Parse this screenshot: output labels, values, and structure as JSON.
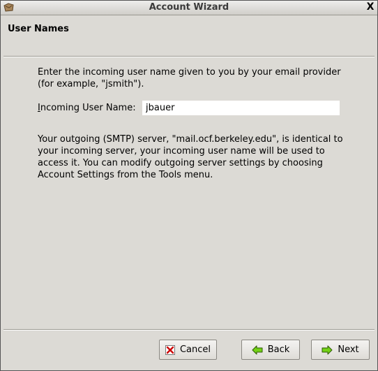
{
  "window": {
    "title": "Account Wizard",
    "close_glyph": "X"
  },
  "page": {
    "header": "User Names",
    "instruction": "Enter the incoming user name given to you by your email provider (for example, \"jsmith\").",
    "field_label_accel": "I",
    "field_label_rest": "ncoming User Name:",
    "field_value": "jbauer",
    "smtp_note": "Your outgoing (SMTP) server, \"mail.ocf.berkeley.edu\", is identical to your incoming server, your incoming user name will be used to access it. You can modify outgoing server settings by choosing Account Settings from the Tools menu."
  },
  "buttons": {
    "cancel": "Cancel",
    "back": "Back",
    "next": "Next"
  },
  "icons": {
    "title": "mail-app-icon",
    "cancel": "cancel-x-icon",
    "back": "arrow-left-icon",
    "next": "arrow-right-icon"
  },
  "colors": {
    "background": "#dcdad5",
    "input_bg": "#ffffff",
    "icon_green": "#4e9a06",
    "icon_red": "#cc0000"
  }
}
